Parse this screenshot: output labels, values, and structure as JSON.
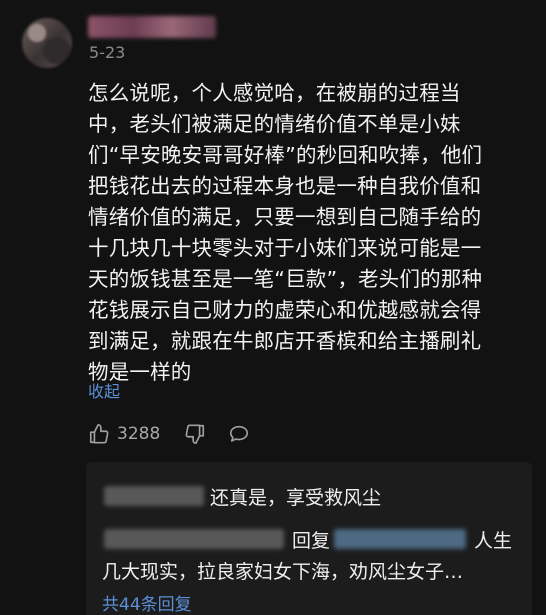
{
  "comment": {
    "date": "5-23",
    "lines": [
      "怎么说呢，个人感觉哈，在被崩的过程当",
      "中，老头们被满足的情绪价值不单是小妹",
      "们“早安晚安哥哥好棒”的秒回和吹捧，他们",
      "把钱花出去的过程本身也是一种自我价值和",
      "情绪价值的满足，只要一想到自己随手给的",
      "十几块几十块零头对于小妹们来说可能是一",
      "天的饭钱甚至是一笔“巨款”，老头们的那种",
      "花钱展示自己财力的虚荣心和优越感就会得",
      "到满足，就跟在牛郎店开香槟和给主播刷礼",
      "物是一样的"
    ],
    "collapse_label": "收起",
    "like_count": "3288"
  },
  "replies": {
    "reply1_text": "还真是，享受救风尘",
    "reply2_part1": "回复",
    "reply2_part2": "人生",
    "reply2_line2": "几大现实，拉良家妇女下海，劝风尘女子…",
    "more_label": "共44条回复"
  },
  "icons": {
    "like": "thumbs-up-icon",
    "dislike": "thumbs-down-icon",
    "reply": "comment-bubble-icon"
  },
  "colors": {
    "background": "#121212",
    "panel": "#1c1c1c",
    "link": "#5b8fd6",
    "text": "#f2f2f2",
    "muted": "#8b8b8b"
  }
}
